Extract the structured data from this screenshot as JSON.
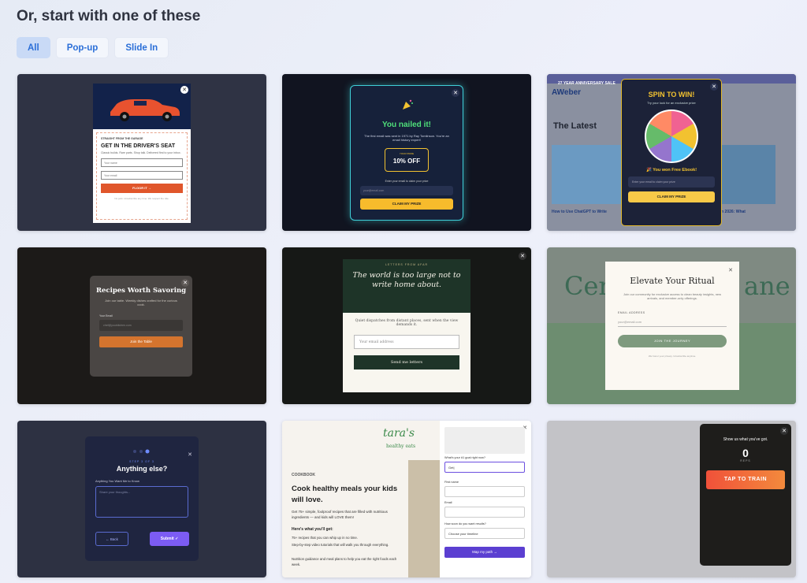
{
  "heading": "Or, start with one of these",
  "filters": [
    "All",
    "Pop-up",
    "Slide In"
  ],
  "templates": {
    "car": {
      "eyebrow": "STRAIGHT FROM THE GARAGE",
      "title": "GET IN THE DRIVER'S SEAT",
      "body": "Classic builds. Rare parts. Shop talk. Delivered first to your inbox.",
      "name_placeholder": "Your name",
      "email_placeholder": "Your email",
      "button": "FLOOR IT →",
      "fine": "No junk. Unsubscribe any time. We respect the ride."
    },
    "prize": {
      "heading": "You nailed it!",
      "body": "The first email was sent in 1971 by Ray Tomlinson. You're an email history expert!",
      "prize_label": "YOUR PRIZE",
      "prize_value": "10% OFF",
      "email_label": "Enter your email to claim your prize",
      "email_placeholder": "your@email.com",
      "button": "CLAIM MY PRIZE"
    },
    "spin": {
      "topbar": "27 YEAR ANNIVERSARY SALE",
      "brand": "AWeber",
      "latest": "The Latest",
      "article1": "How to Use ChatGPT to Write",
      "article2": "ails in 2026: What",
      "heading": "SPIN TO WIN!",
      "sub": "Try your luck for an exclusive prize",
      "won": "🎉 You won Free Ebook!",
      "email_placeholder": "Enter your email to claim your prize",
      "button": "CLAIM MY PRIZE"
    },
    "recipes": {
      "heading": "Recipes Worth Savoring",
      "body": "Join our table. Weekly dishes crafted for the curious cook.",
      "label": "Your Email",
      "placeholder": "chef@yourkitchen.com",
      "button": "Join the Table"
    },
    "letters": {
      "eyebrow": "LETTERS FROM AFAR",
      "heading": "The world is too large not to write home about.",
      "body": "Quiet dispatches from distant places, sent when the view demands it.",
      "placeholder": "Your email address",
      "button": "Send me letters"
    },
    "ritual": {
      "bg_left": "Cer",
      "bg_right": "ane",
      "heading": "Elevate Your Ritual",
      "body": "Join our community for exclusive access to clean beauty insights, new arrivals, and member-only offerings.",
      "label": "EMAIL ADDRESS",
      "placeholder": "your@email.com",
      "button": "JOIN THE JOURNEY",
      "fine": "We honor your privacy. Unsubscribe anytime."
    },
    "survey": {
      "step": "STEP 3 OF 3",
      "heading": "Anything else?",
      "label": "Anything You Want Me to Know",
      "placeholder": "Share your thoughts...",
      "back": "← Back",
      "submit": "Submit ✓"
    },
    "taras": {
      "logo": "tara's",
      "logo_sub": "healthy eats",
      "eyebrow": "COOKBOOK",
      "heading": "Cook healthy meals your kids will love.",
      "body": "Get 75+ simple, foolproof recipes that are filled with nutritious ingredients — and kids will LOVE them!",
      "what": "Here's what you'll get:",
      "bullets": [
        "75+ recipes that you can whip up in no time.",
        "Step-by-step video tutorials that will walk you through everything.",
        "Nutrition guidance and meal plans to help you eat the right foods each week."
      ],
      "q1": "What's your #1 goal right now?",
      "q1_value": "Get|",
      "q2": "First name",
      "q3": "Email",
      "q4": "How soon do you want results?",
      "q4_value": "Choose your timeline",
      "button": "Map my path →"
    },
    "train": {
      "heading": "Show us what you've got.",
      "count": "0",
      "unit": "REPS",
      "button": "TAP TO TRAIN"
    }
  }
}
